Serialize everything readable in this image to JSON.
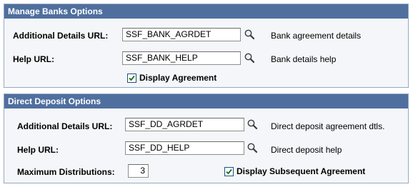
{
  "manage_banks": {
    "title": "Manage Banks Options",
    "additional_details_label": "Additional Details URL:",
    "additional_details_value": "SSF_BANK_AGRDET",
    "additional_details_desc": "Bank agreement details",
    "help_label": "Help URL:",
    "help_value": "SSF_BANK_HELP",
    "help_desc": "Bank details help",
    "display_agreement_label": "Display Agreement",
    "display_agreement_checked": true
  },
  "direct_deposit": {
    "title": "Direct Deposit Options",
    "additional_details_label": "Additional Details URL:",
    "additional_details_value": "SSF_DD_AGRDET",
    "additional_details_desc": "Direct deposit agreement dtls.",
    "help_label": "Help URL:",
    "help_value": "SSF_DD_HELP",
    "help_desc": "Direct deposit help",
    "max_distributions_label": "Maximum Distributions:",
    "max_distributions_value": "3",
    "display_subsequent_label": "Display Subsequent Agreement",
    "display_subsequent_checked": true
  },
  "icons": {
    "lookup": "magnifier-lookup-icon",
    "checkbox": "checkmark-icon"
  },
  "colors": {
    "header_bg": "#4f6f9e",
    "group_bg": "#f4f6f9",
    "group_border": "#96a9c2"
  }
}
